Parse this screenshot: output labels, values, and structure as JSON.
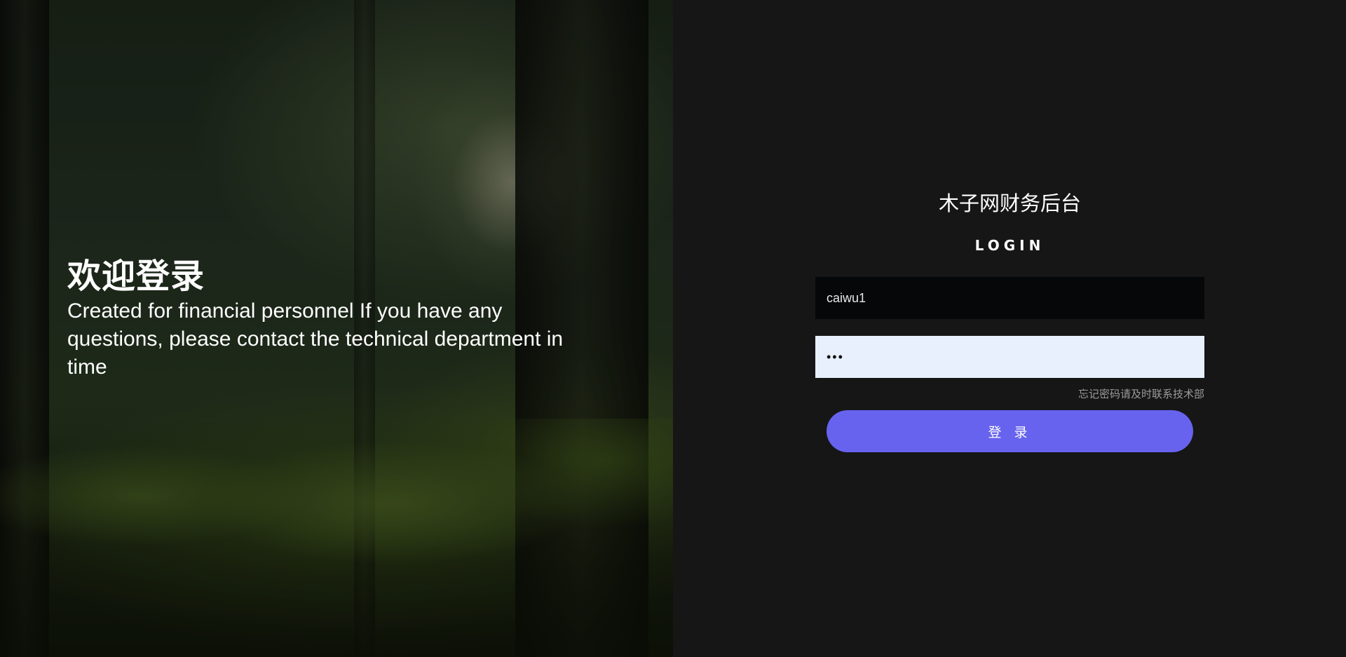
{
  "hero": {
    "title": "欢迎登录",
    "subtitle": "Created for financial personnel If you have any questions, please contact the technical department in time"
  },
  "login": {
    "app_title": "木子网财务后台",
    "heading": "LOGIN",
    "username_value": "caiwu1",
    "password_value": "•••",
    "forgot_text": "忘记密码请及时联系技术部",
    "submit_label": "登 录"
  },
  "colors": {
    "panel_background": "#161616",
    "button_accent": "#6763ee",
    "autofill_background": "#e8f0fe",
    "input_dark_background": "#060709"
  }
}
